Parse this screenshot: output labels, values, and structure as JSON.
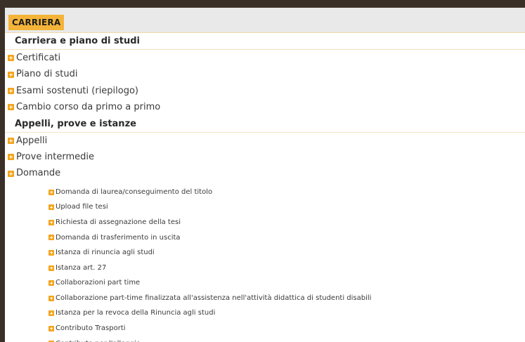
{
  "header": {
    "title": "CARRIERA"
  },
  "sections": [
    {
      "title": "Carriera e piano di studi",
      "items": [
        "Certificati",
        "Piano di studi",
        "Esami sostenuti (riepilogo)",
        "Cambio corso da primo a primo"
      ]
    },
    {
      "title": "Appelli, prove e istanze",
      "items": [
        "Appelli",
        "Prove intermedie",
        "Domande"
      ]
    }
  ],
  "domande_subitems": [
    "Domanda di laurea/conseguimento del titolo",
    "Upload file tesi",
    "Richiesta di assegnazione della tesi",
    "Domanda di trasferimento in uscita",
    "Istanza di rinuncia agli studi",
    "Istanza art. 27",
    "Collaborazioni part time",
    "Collaborazione part-time finalizzata all'assistenza nell'attività didattica di studenti disabili",
    "Istanza per la revoca della Rinuncia agli studi",
    "Contributo Trasporti",
    "Contributo per l'alloggio"
  ],
  "icons": {
    "expand": "plus-square-icon"
  },
  "colors": {
    "accent": "#f4a41c",
    "header_bg": "#e9e9e9",
    "frame": "#3b3027"
  }
}
